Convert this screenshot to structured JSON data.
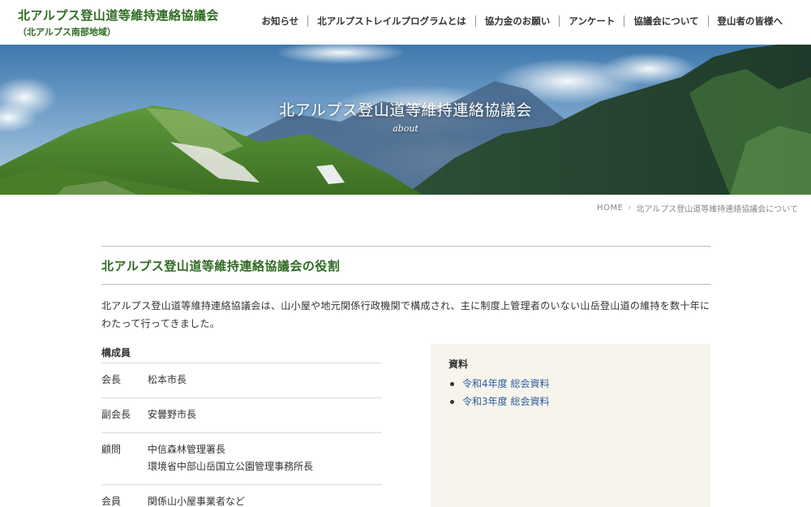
{
  "header": {
    "site_title": "北アルプス登山道等維持連絡協議会",
    "site_subtitle": "（北アルプス南部地域）",
    "nav": [
      {
        "label": "お知らせ"
      },
      {
        "label": "北アルプストレイルプログラムとは"
      },
      {
        "label": "協力金のお願い"
      },
      {
        "label": "アンケート"
      },
      {
        "label": "協議会について"
      },
      {
        "label": "登山者の皆様へ"
      }
    ]
  },
  "hero": {
    "title": "北アルプス登山道等維持連絡協議会",
    "subtitle": "about"
  },
  "breadcrumb": {
    "home": "HOME",
    "separator": "›",
    "current": "北アルプス登山道等維持連絡協議会について"
  },
  "section": {
    "title": "北アルプス登山道等維持連絡協議会の役割",
    "intro": "北アルプス登山道等維持連絡協議会は、山小屋や地元関係行政機関で構成され、主に制度上管理者のいない山岳登山道の維持を数十年にわたって行ってきました。"
  },
  "members": {
    "heading": "構成員",
    "rows": [
      {
        "role": "会長",
        "names": [
          "松本市長"
        ]
      },
      {
        "role": "副会長",
        "names": [
          "安曇野市長"
        ]
      },
      {
        "role": "顧問",
        "names": [
          "中信森林管理署長",
          "環境省中部山岳国立公園管理事務所長"
        ]
      },
      {
        "role": "会員",
        "names": [
          "関係山小屋事業者など"
        ]
      }
    ]
  },
  "resources": {
    "heading": "資料",
    "items": [
      {
        "label": "令和4年度 総会資料"
      },
      {
        "label": "令和3年度 総会資料"
      }
    ]
  },
  "colors": {
    "brand_green": "#2f6b22",
    "link_blue": "#2d5d9e",
    "panel_bg": "#f7f4ec"
  }
}
